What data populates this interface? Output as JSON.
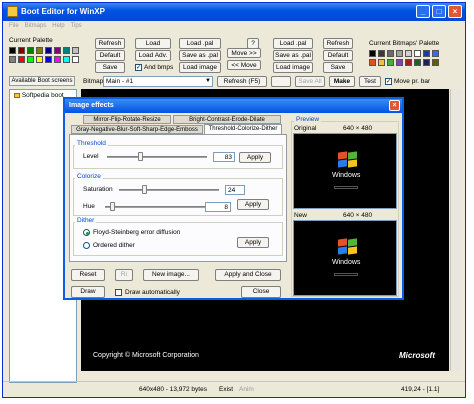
{
  "window": {
    "title": "Boot Editor for WinXP"
  },
  "menu": [
    "File",
    "Bitmaps",
    "Help",
    "Tips"
  ],
  "left_palette": {
    "label": "Current Palette",
    "colors": [
      "#000000",
      "#800000",
      "#008000",
      "#808000",
      "#000080",
      "#800080",
      "#008080",
      "#c0c0c0",
      "#808080",
      "#ff0000",
      "#00ff00",
      "#ffff00",
      "#0000ff",
      "#ff00ff",
      "#00ffff",
      "#ffffff"
    ]
  },
  "right_palette": {
    "label": "Current Bitmaps' Palette",
    "colors": [
      "#000000",
      "#3a3a3a",
      "#6b6b6b",
      "#a0a0a0",
      "#d0d0d0",
      "#ffffff",
      "#1a3aa8",
      "#2a6ff0",
      "#e05020",
      "#f0c040",
      "#40b040",
      "#8040c0",
      "#a02020",
      "#206020",
      "#202060",
      "#606000"
    ]
  },
  "toolbar": {
    "refresh": "Refresh",
    "load": "Load",
    "load_pal": "Load .pal",
    "question": "?",
    "default": "Default",
    "load_adv": "Load Adv.",
    "save_as_pal": "Save as .pal",
    "save": "Save",
    "and_bmps": "And bmps",
    "load_image": "Load image",
    "move_right": "Move >>",
    "move_left": "<< Move",
    "r_refresh": "Refresh",
    "r_default": "Default",
    "r_save": "Save"
  },
  "row2": {
    "available": "Available Boot screens",
    "bitmap_label": "Bitmap",
    "bitmap_value": "Main - #1",
    "refresh_f5": "Refresh (F5)",
    "save_all": "Save All",
    "make": "Make",
    "test": "Test",
    "move_pr_bar": "Move pr. bar"
  },
  "tree": {
    "item": "Softpedia boot"
  },
  "dialog": {
    "title": "Image effects",
    "tabs_row1": [
      "Mirror-Flip-Rotate-Resize",
      "Bright-Contrast-Erode-Dilate"
    ],
    "tabs_row2": [
      "Gray-Negative-Blur-Soft-Sharp-Edge-Emboss",
      "Threshold-Colorize-Dither"
    ],
    "threshold": {
      "title": "Threshold",
      "level_label": "Level",
      "level_value": "83",
      "level_fraction": 0.33,
      "apply": "Apply"
    },
    "colorize": {
      "title": "Colorize",
      "saturation_label": "Saturation",
      "saturation_value": "24",
      "saturation_fraction": 0.24,
      "hue_label": "Hue",
      "hue_value": "8",
      "hue_fraction": 0.05,
      "apply": "Apply"
    },
    "dither": {
      "title": "Dither",
      "option1": "Floyd-Steinberg error diffusion",
      "option2": "Ordered dither",
      "apply": "Apply"
    },
    "reset": "Reset",
    "undo_icon": "Ri",
    "new_image": "New image...",
    "apply_close": "Apply and Close",
    "draw": "Draw",
    "draw_auto": "Draw automatically",
    "close": "Close",
    "preview": {
      "title": "Preview",
      "original": "Original",
      "new": "New",
      "size": "640 × 480",
      "logo_text": "Windows"
    }
  },
  "canvas": {
    "copyright": "Copyright © Microsoft Corporation",
    "brand": "Microsoft"
  },
  "status": {
    "size": "640x480 - 13,972 bytes",
    "exist": "Exist",
    "anim": "Anim",
    "coords": "419,24 - [1.1]"
  }
}
